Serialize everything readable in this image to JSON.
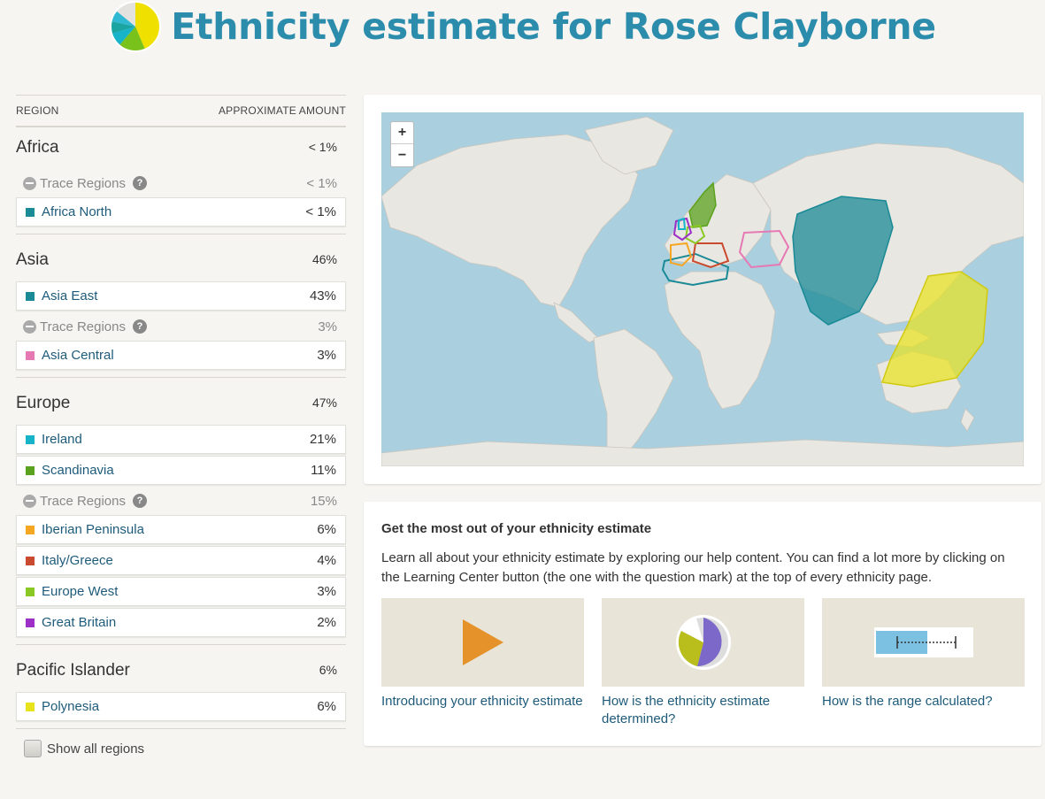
{
  "page": {
    "title": "Ethnicity estimate for Rose Clayborne"
  },
  "table": {
    "col_region": "Region",
    "col_amount": "Approximate amount"
  },
  "groups": [
    {
      "name": "Africa",
      "pct": "< 1%",
      "trace": {
        "label": "Trace Regions",
        "pct": "< 1%"
      },
      "regions": [
        {
          "name": "Africa North",
          "pct": "< 1%",
          "color": "#1a8a96"
        }
      ]
    },
    {
      "name": "Asia",
      "pct": "46%",
      "regions": [
        {
          "name": "Asia East",
          "pct": "43%",
          "color": "#1a8a96"
        }
      ],
      "trace": {
        "label": "Trace Regions",
        "pct": "3%"
      },
      "trace_regions": [
        {
          "name": "Asia Central",
          "pct": "3%",
          "color": "#e678b4"
        }
      ]
    },
    {
      "name": "Europe",
      "pct": "47%",
      "regions": [
        {
          "name": "Ireland",
          "pct": "21%",
          "color": "#17b3c9"
        },
        {
          "name": "Scandinavia",
          "pct": "11%",
          "color": "#5aa21d"
        }
      ],
      "trace": {
        "label": "Trace Regions",
        "pct": "15%"
      },
      "trace_regions": [
        {
          "name": "Iberian Peninsula",
          "pct": "6%",
          "color": "#f5a623"
        },
        {
          "name": "Italy/Greece",
          "pct": "4%",
          "color": "#c94a2e"
        },
        {
          "name": "Europe West",
          "pct": "3%",
          "color": "#8ac924"
        },
        {
          "name": "Great Britain",
          "pct": "2%",
          "color": "#9b2fc7"
        }
      ]
    },
    {
      "name": "Pacific Islander",
      "pct": "6%",
      "regions": [
        {
          "name": "Polynesia",
          "pct": "6%",
          "color": "#e8e21b"
        }
      ]
    }
  ],
  "show_all": {
    "label": "Show all regions"
  },
  "map": {
    "zoom_in": "+",
    "zoom_out": "−"
  },
  "info": {
    "title": "Get the most out of your ethnicity estimate",
    "body": "Learn all about your ethnicity estimate by exploring our help content. You can find a lot more by clicking on the Learning Center button (the one with the question mark) at the top of every ethnicity page.",
    "tiles": [
      {
        "label": "Introducing your ethnicity estimate",
        "icon": "play-icon"
      },
      {
        "label": "How is the ethnicity estimate determined?",
        "icon": "pie-chart-icon"
      },
      {
        "label": "How is the range calculated?",
        "icon": "range-bar-icon"
      }
    ]
  },
  "colors": {
    "title": "#2b8cac",
    "link": "#1e5b7a",
    "background": "#f6f5f1"
  }
}
